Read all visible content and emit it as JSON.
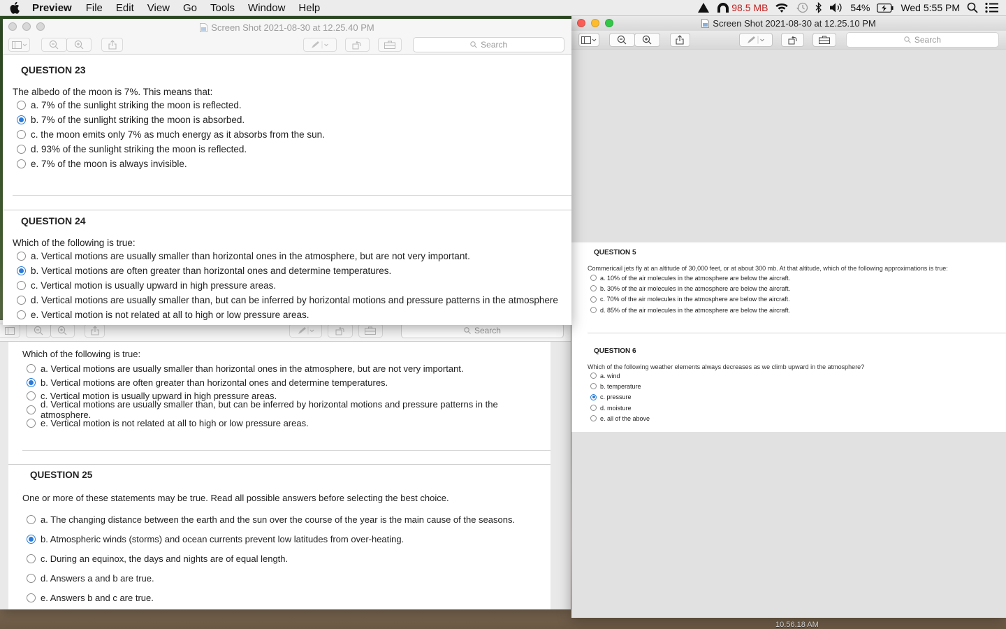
{
  "menubar": {
    "app_name": "Preview",
    "items": [
      "File",
      "Edit",
      "View",
      "Go",
      "Tools",
      "Window",
      "Help"
    ],
    "memory": "98.5 MB",
    "battery": "54%",
    "clock": "Wed 5:55 PM"
  },
  "front_window": {
    "title": "Screen Shot 2021-08-30 at 12.25.40 PM",
    "search_placeholder": "Search",
    "q23": {
      "heading": "QUESTION 23",
      "prompt": "The albedo of the moon is 7%. This means that:",
      "options": [
        "a. 7% of the sunlight striking the moon is reflected.",
        "b. 7% of the sunlight striking the moon is absorbed.",
        "c. the moon emits only 7% as much energy as it absorbs from the sun.",
        "d. 93% of the sunlight striking the moon is reflected.",
        "e. 7% of the moon is always invisible."
      ],
      "selected": 1
    },
    "q24": {
      "heading": "QUESTION 24",
      "prompt": "Which of the following is true:",
      "options": [
        "a. Vertical motions are usually smaller than horizontal ones in the atmosphere, but are not very important.",
        "b. Vertical motions are often greater than horizontal ones and determine temperatures.",
        "c. Vertical motion is usually upward in high pressure areas.",
        "d. Vertical motions are usually smaller than, but can be inferred by horizontal motions and pressure patterns in the atmosphere",
        "e. Vertical motion is not related at all to high or low pressure areas."
      ],
      "selected": 1
    }
  },
  "back_window": {
    "search_placeholder": "Search",
    "q24": {
      "prompt": "Which of the following is true:",
      "options": [
        "a. Vertical motions are usually smaller than horizontal ones in the atmosphere, but are not very important.",
        "b. Vertical motions are often greater than horizontal ones and determine temperatures.",
        "c. Vertical motion is usually upward in high pressure areas.",
        "d. Vertical motions are usually smaller than, but can be inferred by horizontal motions and pressure patterns in the atmosphere.",
        "e. Vertical motion is not related at all to high or low pressure areas."
      ],
      "selected": 1
    },
    "q25": {
      "heading": "QUESTION 25",
      "prompt": "One or more of these statements may be true. Read all possible answers before selecting the best choice.",
      "options": [
        "a. The changing distance between the earth and the sun over the course of the year is the main cause of the seasons.",
        "b. Atmospheric winds (storms) and ocean currents prevent low latitudes from over-heating.",
        "c. During an equinox, the days and nights are of equal length.",
        "d. Answers a and b are true.",
        "e. Answers b and c are true."
      ],
      "selected": 1
    }
  },
  "right_window": {
    "title": "Screen Shot 2021-08-30 at 12.25.10 PM",
    "search_placeholder": "Search",
    "q5": {
      "heading": "QUESTION 5",
      "prompt": "Commericail jets fly at an altitude of 30,000 feet, or at about 300 mb. At that altitude, which of the following approximations is true:",
      "options": [
        "a. 10% of the air molecules in the atmosphere are below the aircraft.",
        "b. 30% of the air molecules in the atmosphere are below the aircraft.",
        "c. 70% of the air molecules in the atmosphere are below the aircraft.",
        "d. 85% of the air molecules in the atmosphere are below the aircraft."
      ],
      "selected": -1
    },
    "q6": {
      "heading": "QUESTION 6",
      "prompt": "Which of the following weather elements always decreases as we climb upward in the atmosphere?",
      "options": [
        "a. wind",
        "b. temperature",
        "c. pressure",
        "d. moisture",
        "e. all of the above"
      ],
      "selected": 2
    }
  },
  "desktop": {
    "file_label": "10.56.18 AM"
  },
  "colors": {
    "accent": "#2a7bd9",
    "close": "#fc5f57",
    "minimize": "#fdbc2e",
    "zoom": "#33c748",
    "memory_text": "#c21d1d"
  }
}
